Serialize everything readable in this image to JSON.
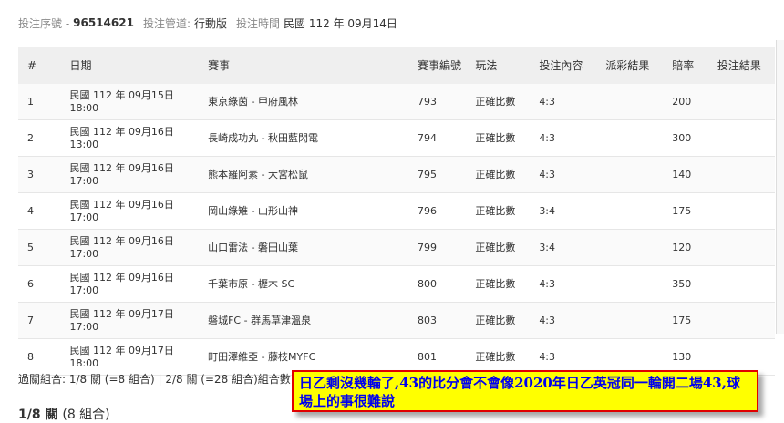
{
  "header": {
    "serial_label": "投注序號 -",
    "serial_value": "96514621",
    "channel_label": "投注管道:",
    "channel_value": "行動版",
    "time_label": "投注時間",
    "time_value": "民國 112 年 09月14日"
  },
  "table": {
    "columns": [
      "#",
      "日期",
      "賽事",
      "賽事編號",
      "玩法",
      "投注內容",
      "派彩結果",
      "賠率",
      "投注結果"
    ],
    "rows": [
      {
        "no": "1",
        "date": "民國 112 年 09月15日",
        "time": "18:00",
        "match": "東京綠茵 - 甲府風林",
        "code": "793",
        "play": "正確比數",
        "content": "4:3",
        "result": "",
        "odds": "200",
        "outcome": ""
      },
      {
        "no": "2",
        "date": "民國 112 年 09月16日",
        "time": "13:00",
        "match": "長崎成功丸 - 秋田藍閃電",
        "code": "794",
        "play": "正確比數",
        "content": "4:3",
        "result": "",
        "odds": "300",
        "outcome": ""
      },
      {
        "no": "3",
        "date": "民國 112 年 09月16日",
        "time": "17:00",
        "match": "熊本羅阿素 - 大宮松鼠",
        "code": "795",
        "play": "正確比數",
        "content": "4:3",
        "result": "",
        "odds": "140",
        "outcome": ""
      },
      {
        "no": "4",
        "date": "民國 112 年 09月16日",
        "time": "17:00",
        "match": "岡山綠雉 - 山形山神",
        "code": "796",
        "play": "正確比數",
        "content": "3:4",
        "result": "",
        "odds": "175",
        "outcome": ""
      },
      {
        "no": "5",
        "date": "民國 112 年 09月16日",
        "time": "17:00",
        "match": "山口雷法 - 磐田山葉",
        "code": "799",
        "play": "正確比數",
        "content": "3:4",
        "result": "",
        "odds": "120",
        "outcome": ""
      },
      {
        "no": "6",
        "date": "民國 112 年 09月16日",
        "time": "17:00",
        "match": "千葉市原 - 櫪木 SC",
        "code": "800",
        "play": "正確比數",
        "content": "4:3",
        "result": "",
        "odds": "350",
        "outcome": ""
      },
      {
        "no": "7",
        "date": "民國 112 年 09月17日",
        "time": "17:00",
        "match": "磐城FC - 群馬草津溫泉",
        "code": "803",
        "play": "正確比數",
        "content": "4:3",
        "result": "",
        "odds": "175",
        "outcome": ""
      },
      {
        "no": "8",
        "date": "民國 112 年 09月17日",
        "time": "18:00",
        "match": "町田澤維亞 - 藤枝MYFC",
        "code": "801",
        "play": "正確比數",
        "content": "4:3",
        "result": "",
        "odds": "130",
        "outcome": ""
      }
    ]
  },
  "summary": "過關組合: 1/8 關 (=8 組合) | 2/8 關 (=28 組合)組合數: 36",
  "section": {
    "title": "1/8 關",
    "subtitle": "(8 組合)"
  },
  "annotation": "日乙剩沒幾輪了,43的比分會不會像2020年日乙英冠同一輪開二場43,球場上的事很難說",
  "colors": {
    "annotation_bg": "#ffff00",
    "annotation_border": "#e00000",
    "annotation_text": "#0000ee",
    "table_header_bg": "#efefef"
  }
}
